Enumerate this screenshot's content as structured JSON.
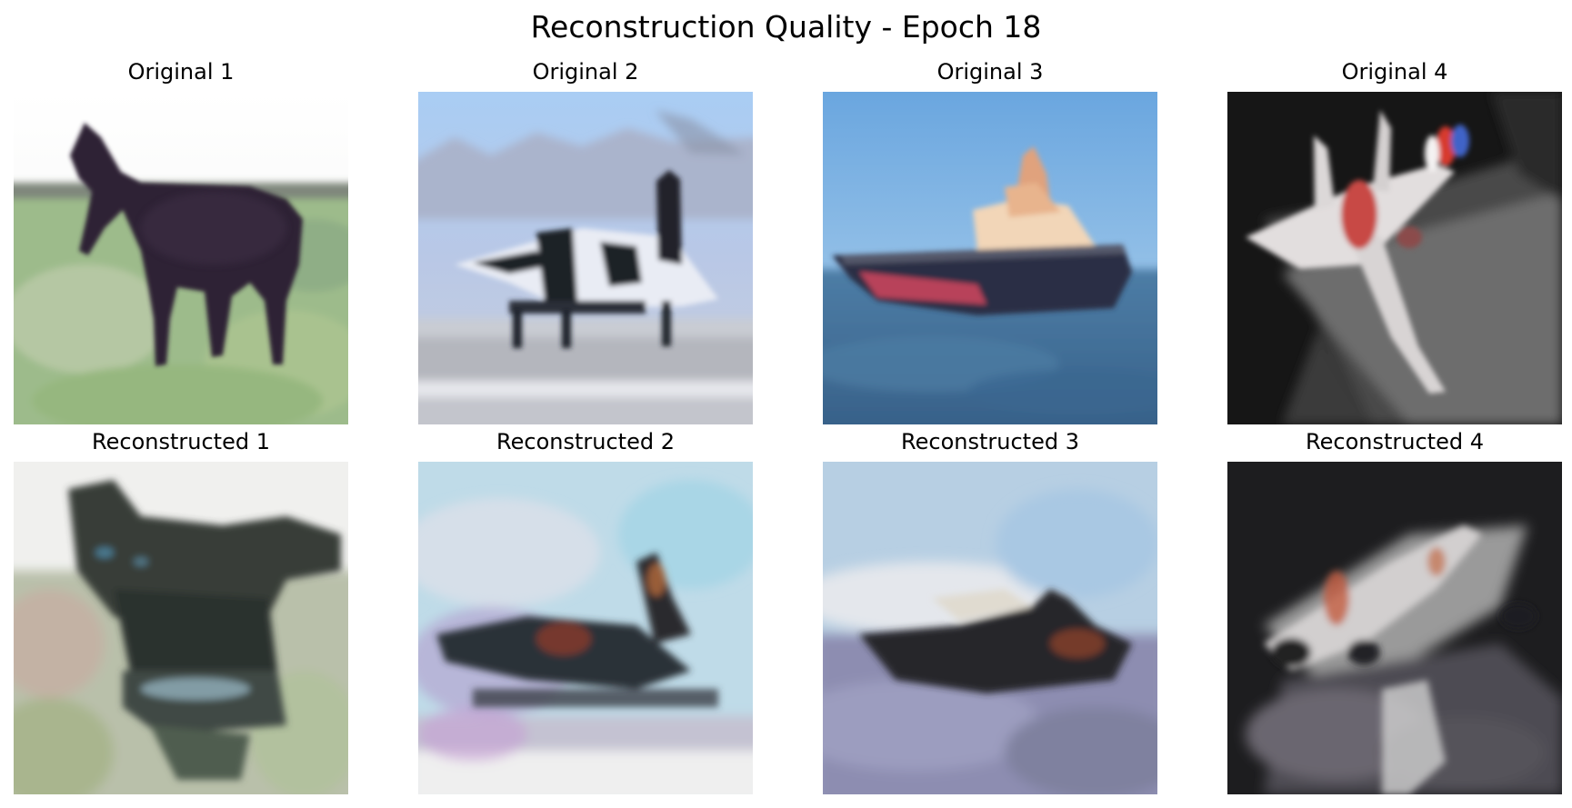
{
  "figure": {
    "title": "Reconstruction Quality - Epoch 18"
  },
  "panels": {
    "original_1": {
      "title": "Original 1",
      "subject": "horse"
    },
    "original_2": {
      "title": "Original 2",
      "subject": "airplane"
    },
    "original_3": {
      "title": "Original 3",
      "subject": "ship"
    },
    "original_4": {
      "title": "Original 4",
      "subject": "airplane"
    },
    "reconstructed_1": {
      "title": "Reconstructed 1",
      "subject": "horse"
    },
    "reconstructed_2": {
      "title": "Reconstructed 2",
      "subject": "airplane"
    },
    "reconstructed_3": {
      "title": "Reconstructed 3",
      "subject": "ship"
    },
    "reconstructed_4": {
      "title": "Reconstructed 4",
      "subject": "airplane"
    }
  }
}
